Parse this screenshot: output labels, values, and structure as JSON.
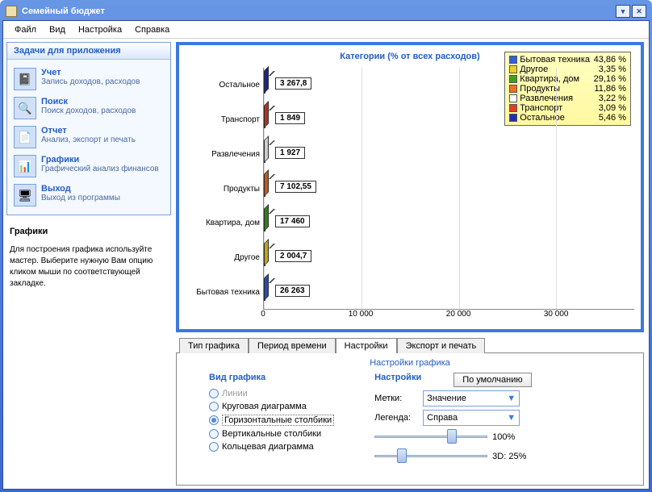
{
  "window": {
    "title": "Семейный бюджет"
  },
  "menu": [
    "Файл",
    "Вид",
    "Настройка",
    "Справка"
  ],
  "taskpanel": {
    "heading": "Задачи для приложения",
    "items": [
      {
        "title": "Учет",
        "desc": "Запись доходов, расходов",
        "icon": "📓"
      },
      {
        "title": "Поиск",
        "desc": "Поиск доходов, расходов",
        "icon": "🔍"
      },
      {
        "title": "Отчет",
        "desc": "Анализ, экспорт и печать",
        "icon": "📄"
      },
      {
        "title": "Графики",
        "desc": "Графический анализ финансов",
        "icon": "📊"
      },
      {
        "title": "Выход",
        "desc": "Выход из программы",
        "icon": "🖥"
      }
    ]
  },
  "help": {
    "heading": "Графики",
    "text": "Для построения графика используйте мастер. Выберите нужную Вам опцию кликом мыши по соответствующей закладке."
  },
  "chart_data": {
    "type": "bar",
    "orientation": "horizontal",
    "title": "Категории (% от всех расходов)",
    "categories": [
      "Остальное",
      "Транспорт",
      "Развлечения",
      "Продукты",
      "Квартира, дом",
      "Другое",
      "Бытовая техника"
    ],
    "values": [
      3267.8,
      1849,
      1927,
      7102.55,
      17460,
      2004.7,
      26263
    ],
    "value_labels": [
      "3 267,8",
      "1 849",
      "1 927",
      "7 102,55",
      "17 460",
      "2 004,7",
      "26 263"
    ],
    "colors": [
      "#2030b0",
      "#e04020",
      "#ffffff",
      "#f07020",
      "#40a020",
      "#f0d020",
      "#3060e0"
    ],
    "xticks": [
      0,
      10000,
      20000,
      30000
    ],
    "xtick_labels": [
      "0",
      "10 000",
      "20 000",
      "30 000"
    ],
    "xlim": [
      0,
      38000
    ],
    "legend": [
      {
        "label": "Бытовая техника",
        "pct": "43,86 %",
        "color": "#3060e0"
      },
      {
        "label": "Другое",
        "pct": "3,35 %",
        "color": "#f0d020"
      },
      {
        "label": "Квартира, дом",
        "pct": "29,16 %",
        "color": "#40a020"
      },
      {
        "label": "Продукты",
        "pct": "11,86 %",
        "color": "#f07020"
      },
      {
        "label": "Развлечения",
        "pct": "3,22 %",
        "color": "#ffffff"
      },
      {
        "label": "Транспорт",
        "pct": "3,09 %",
        "color": "#e04020"
      },
      {
        "label": "Остальное",
        "pct": "5,46 %",
        "color": "#2030b0"
      }
    ]
  },
  "tabs": {
    "items": [
      "Тип графика",
      "Период времени",
      "Настройки",
      "Экспорт и печать"
    ],
    "active": 2
  },
  "settings": {
    "title": "Настройки графика",
    "col1": {
      "heading": "Вид графика",
      "radios": [
        {
          "label": "Линии",
          "checked": false,
          "disabled": true
        },
        {
          "label": "Круговая диаграмма",
          "checked": false,
          "disabled": false
        },
        {
          "label": "Горизонтальные столбики",
          "checked": true,
          "disabled": false
        },
        {
          "label": "Вертикальные столбики",
          "checked": false,
          "disabled": false
        },
        {
          "label": "Кольцевая диаграмма",
          "checked": false,
          "disabled": false
        }
      ]
    },
    "col2": {
      "heading": "Настройки",
      "default_btn": "По умолчанию",
      "labels_label": "Метки:",
      "labels_value": "Значение",
      "legend_label": "Легенда:",
      "legend_value": "Справа",
      "slider1": "100%",
      "slider2": "3D: 25%"
    }
  }
}
